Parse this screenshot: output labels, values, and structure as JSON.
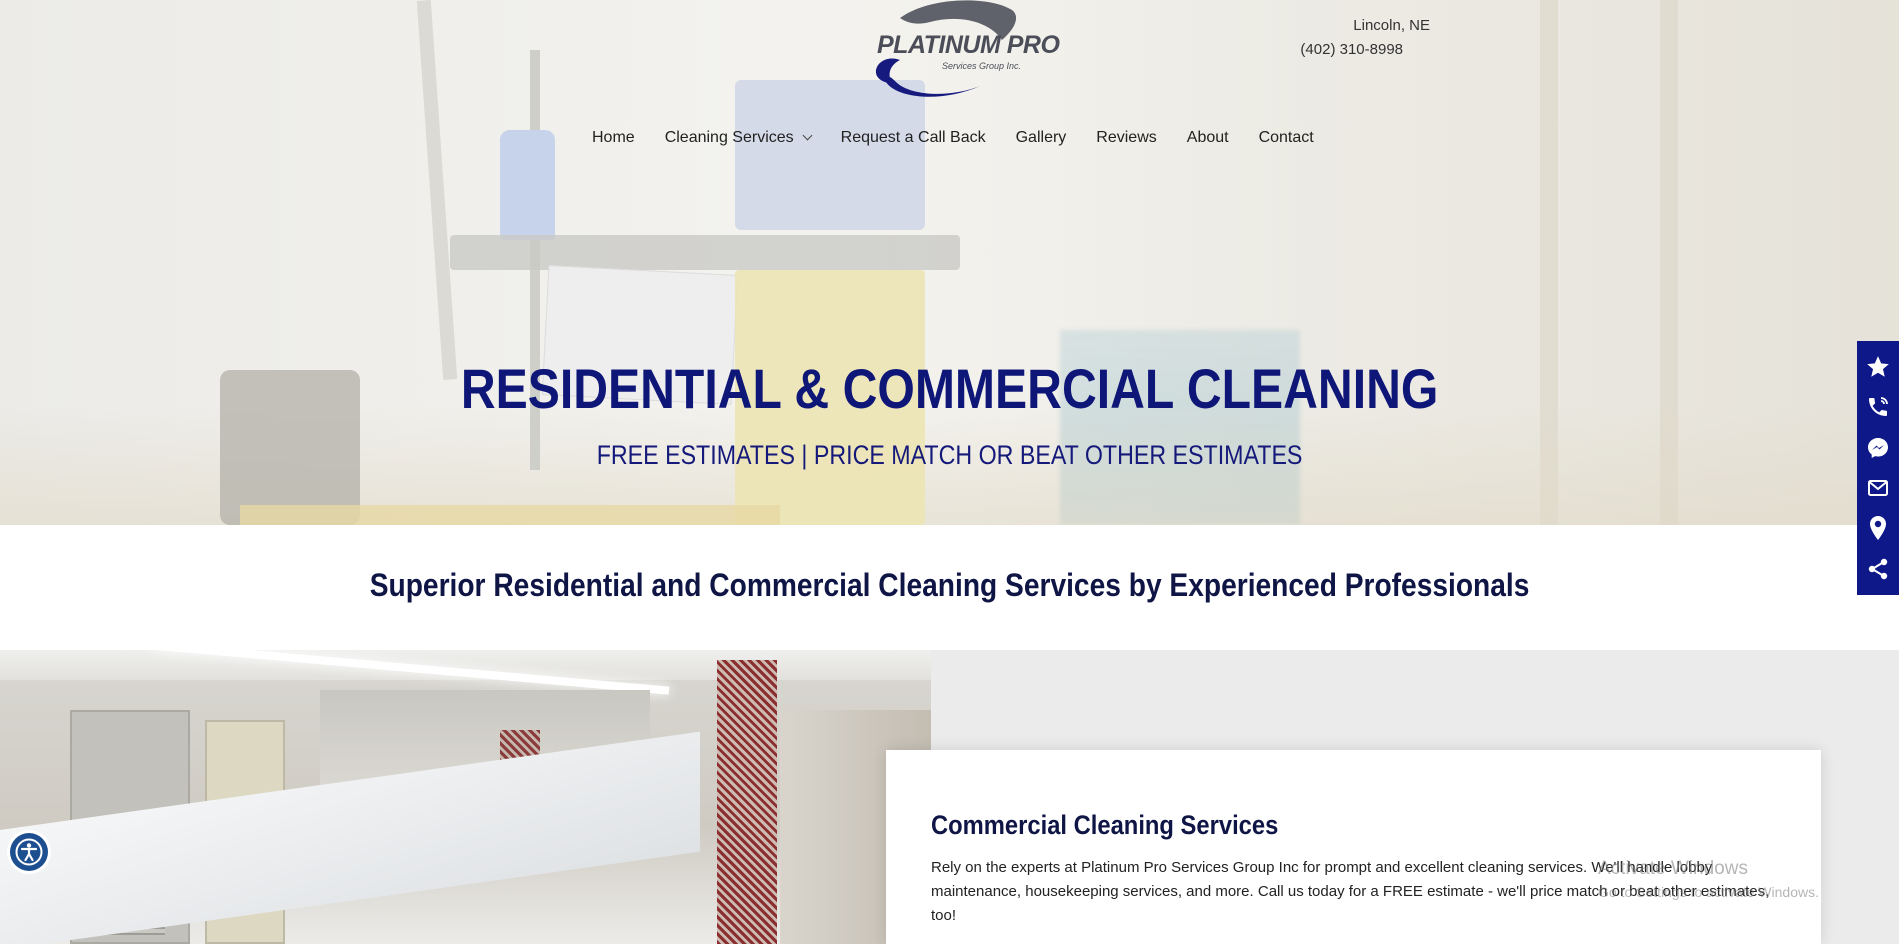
{
  "header": {
    "logo_title": "PLATINUM PRO",
    "logo_subtitle": "Services Group Inc.",
    "location": "Lincoln, NE",
    "phone": "(402) 310-8998"
  },
  "nav": {
    "items": [
      {
        "label": "Home"
      },
      {
        "label": "Cleaning Services",
        "has_dropdown": true
      },
      {
        "label": "Request a Call Back"
      },
      {
        "label": "Gallery"
      },
      {
        "label": "Reviews"
      },
      {
        "label": "About"
      },
      {
        "label": "Contact"
      }
    ]
  },
  "hero": {
    "title": "RESIDENTIAL & COMMERCIAL CLEANING",
    "subtitle": "FREE ESTIMATES | PRICE MATCH OR BEAT OTHER ESTIMATES"
  },
  "tagline": "Superior Residential and Commercial Cleaning Services by Experienced Professionals",
  "services_card": {
    "title": "Commercial Cleaning Services",
    "body": "Rely on the experts at Platinum Pro Services Group Inc for prompt and excellent cleaning services. We'll handle lobby maintenance, housekeeping services, and more. Call us today for a FREE estimate - we'll price match or beat other estimates, too!"
  },
  "watermark": {
    "line1": "Activate Windows",
    "line2": "Go to Settings to activate Windows."
  },
  "floating_bar": {
    "icons": [
      "star-icon",
      "phone-icon",
      "messenger-icon",
      "mail-icon",
      "map-pin-icon",
      "share-icon"
    ]
  },
  "colors": {
    "brand_navy": "#0e1677",
    "float_bar": "#0f1889",
    "accessibility": "#1c4e90"
  }
}
